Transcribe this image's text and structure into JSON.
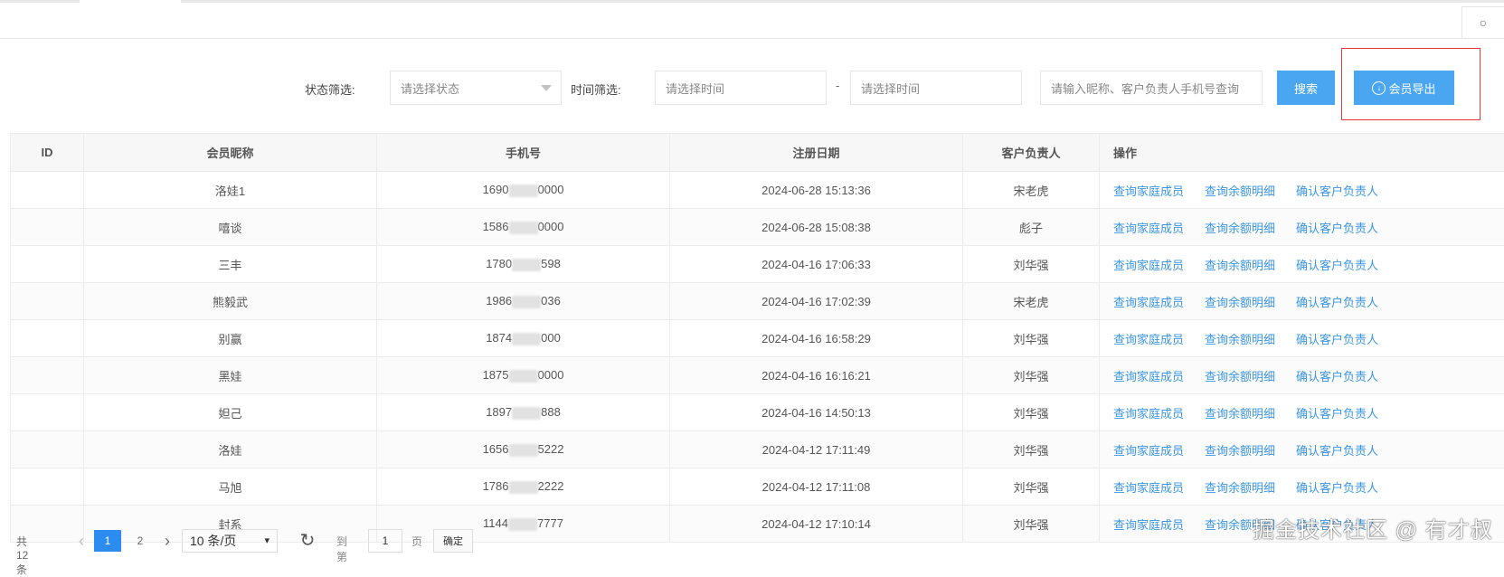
{
  "header": {
    "refresh_icon": "refresh-icon",
    "refresh_glyph": "○"
  },
  "filters": {
    "status_label": "状态筛选:",
    "status_placeholder": "请选择状态",
    "time_label": "时间筛选:",
    "start_placeholder": "请选择时间",
    "range_separator": "-",
    "end_placeholder": "请选择时间",
    "keyword_placeholder": "请输入昵称、客户负责人手机号查询",
    "search_label": "搜索",
    "export_label": "会员导出",
    "export_icon": "download-circle-icon"
  },
  "table": {
    "columns": [
      "ID",
      "会员昵称",
      "手机号",
      "注册日期",
      "客户负责人",
      "操作"
    ],
    "actions": [
      "查询家庭成员",
      "查询余额明细",
      "确认客户负责人"
    ],
    "rows": [
      {
        "id": "",
        "nickname": "洛娃1",
        "phone_prefix": "1690",
        "phone_suffix": "0000",
        "date": "2024-06-28 15:13:36",
        "owner": "宋老虎"
      },
      {
        "id": "",
        "nickname": "嘻谈",
        "phone_prefix": "1586",
        "phone_suffix": "0000",
        "date": "2024-06-28 15:08:38",
        "owner": "彪子"
      },
      {
        "id": "",
        "nickname": "三丰",
        "phone_prefix": "1780",
        "phone_suffix": "598",
        "date": "2024-04-16 17:06:33",
        "owner": "刘华强"
      },
      {
        "id": "",
        "nickname": "熊毅武",
        "phone_prefix": "1986",
        "phone_suffix": "036",
        "date": "2024-04-16 17:02:39",
        "owner": "宋老虎"
      },
      {
        "id": "",
        "nickname": "别赢",
        "phone_prefix": "1874",
        "phone_suffix": "000",
        "date": "2024-04-16 16:58:29",
        "owner": "刘华强"
      },
      {
        "id": "",
        "nickname": "黑娃",
        "phone_prefix": "1875",
        "phone_suffix": "0000",
        "date": "2024-04-16 16:16:21",
        "owner": "刘华强"
      },
      {
        "id": "",
        "nickname": "妲己",
        "phone_prefix": "1897",
        "phone_suffix": "888",
        "date": "2024-04-16 14:50:13",
        "owner": "刘华强"
      },
      {
        "id": "",
        "nickname": "洛娃",
        "phone_prefix": "1656",
        "phone_suffix": "5222",
        "date": "2024-04-12 17:11:49",
        "owner": "刘华强"
      },
      {
        "id": "",
        "nickname": "马旭",
        "phone_prefix": "1786",
        "phone_suffix": "2222",
        "date": "2024-04-12 17:11:08",
        "owner": "刘华强"
      },
      {
        "id": "",
        "nickname": "封系",
        "phone_prefix": "1144",
        "phone_suffix": "7777",
        "date": "2024-04-12 17:10:14",
        "owner": "刘华强"
      }
    ]
  },
  "pagination": {
    "total": "共 12 条",
    "prev_glyph": "‹",
    "pages": [
      "1",
      "2"
    ],
    "next_glyph": "›",
    "page_size": "10 条/页",
    "refresh_glyph": "↻",
    "goto_label": "到第",
    "goto_value": "1",
    "page_unit": "页",
    "confirm_label": "确定"
  },
  "watermark": "掘金技术社区 @ 有才叔"
}
